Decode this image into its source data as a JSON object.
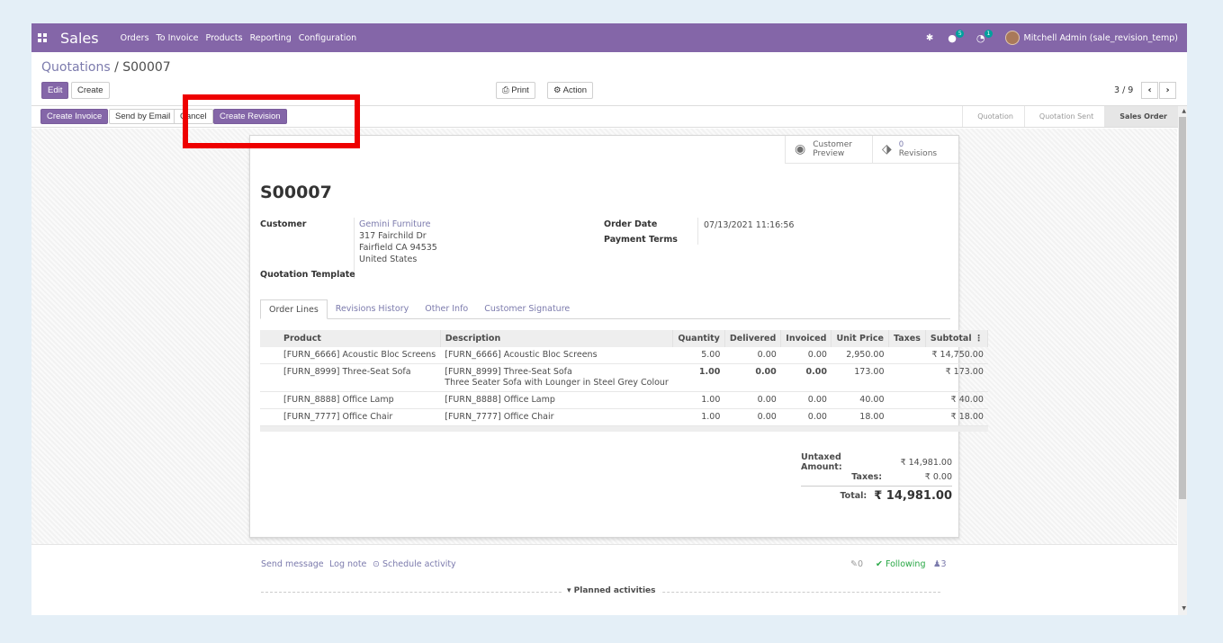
{
  "navbar": {
    "app_name": "Sales",
    "menu": [
      "Orders",
      "To Invoice",
      "Products",
      "Reporting",
      "Configuration"
    ],
    "chat_count": "5",
    "activity_count": "1",
    "user": "Mitchell Admin (sale_revision_temp)"
  },
  "breadcrumb": {
    "parent": "Quotations",
    "separator": "/",
    "current": "S00007"
  },
  "toolbar": {
    "edit": "Edit",
    "create": "Create",
    "print": "Print",
    "action": "Action",
    "pager": "3 / 9"
  },
  "header_buttons": {
    "create_invoice": "Create Invoice",
    "send_by_email": "Send by Email",
    "cancel": "Cancel",
    "create_revision": "Create Revision"
  },
  "stages": [
    "Quotation",
    "Quotation Sent",
    "Sales Order"
  ],
  "smart_buttons": {
    "preview_label_1": "Customer",
    "preview_label_2": "Preview",
    "revisions_count": "0",
    "revisions_label": "Revisions"
  },
  "order": {
    "name": "S00007",
    "customer_label": "Customer",
    "customer_name": "Gemini Furniture",
    "address_1": "317 Fairchild Dr",
    "address_2": "Fairfield CA 94535",
    "address_3": "United States",
    "template_label": "Quotation Template",
    "order_date_label": "Order Date",
    "order_date": "07/13/2021 11:16:56",
    "payment_terms_label": "Payment Terms"
  },
  "tabs": [
    "Order Lines",
    "Revisions History",
    "Other Info",
    "Customer Signature"
  ],
  "table": {
    "headers": [
      "Product",
      "Description",
      "Quantity",
      "Delivered",
      "Invoiced",
      "Unit Price",
      "Taxes",
      "Subtotal"
    ],
    "rows": [
      {
        "product": "[FURN_6666] Acoustic Bloc Screens",
        "desc": "[FURN_6666] Acoustic Bloc Screens",
        "desc2": "",
        "qty": "5.00",
        "delivered": "0.00",
        "invoiced": "0.00",
        "price": "2,950.00",
        "taxes": "",
        "subtotal": "₹ 14,750.00"
      },
      {
        "product": "[FURN_8999] Three-Seat Sofa",
        "desc": "[FURN_8999] Three-Seat Sofa",
        "desc2": "Three Seater Sofa with Lounger in Steel Grey Colour",
        "qty": "1.00",
        "delivered": "0.00",
        "invoiced": "0.00",
        "price": "173.00",
        "taxes": "",
        "subtotal": "₹ 173.00"
      },
      {
        "product": "[FURN_8888] Office Lamp",
        "desc": "[FURN_8888] Office Lamp",
        "desc2": "",
        "qty": "1.00",
        "delivered": "0.00",
        "invoiced": "0.00",
        "price": "40.00",
        "taxes": "",
        "subtotal": "₹ 40.00"
      },
      {
        "product": "[FURN_7777] Office Chair",
        "desc": "[FURN_7777] Office Chair",
        "desc2": "",
        "qty": "1.00",
        "delivered": "0.00",
        "invoiced": "0.00",
        "price": "18.00",
        "taxes": "",
        "subtotal": "₹ 18.00"
      }
    ]
  },
  "totals": {
    "untaxed_label": "Untaxed Amount:",
    "untaxed": "₹ 14,981.00",
    "taxes_label": "Taxes:",
    "taxes": "₹ 0.00",
    "total_label": "Total:",
    "total": "₹ 14,981.00"
  },
  "chatter": {
    "send_message": "Send message",
    "log_note": "Log note",
    "schedule": "Schedule activity",
    "attachments": "0",
    "following": "Following",
    "followers": "3",
    "planned": "Planned activities"
  },
  "colors": {
    "brand": "#8466a8",
    "link": "#7c7bad",
    "teal": "#00a09d",
    "highlight": "#ee0000"
  }
}
